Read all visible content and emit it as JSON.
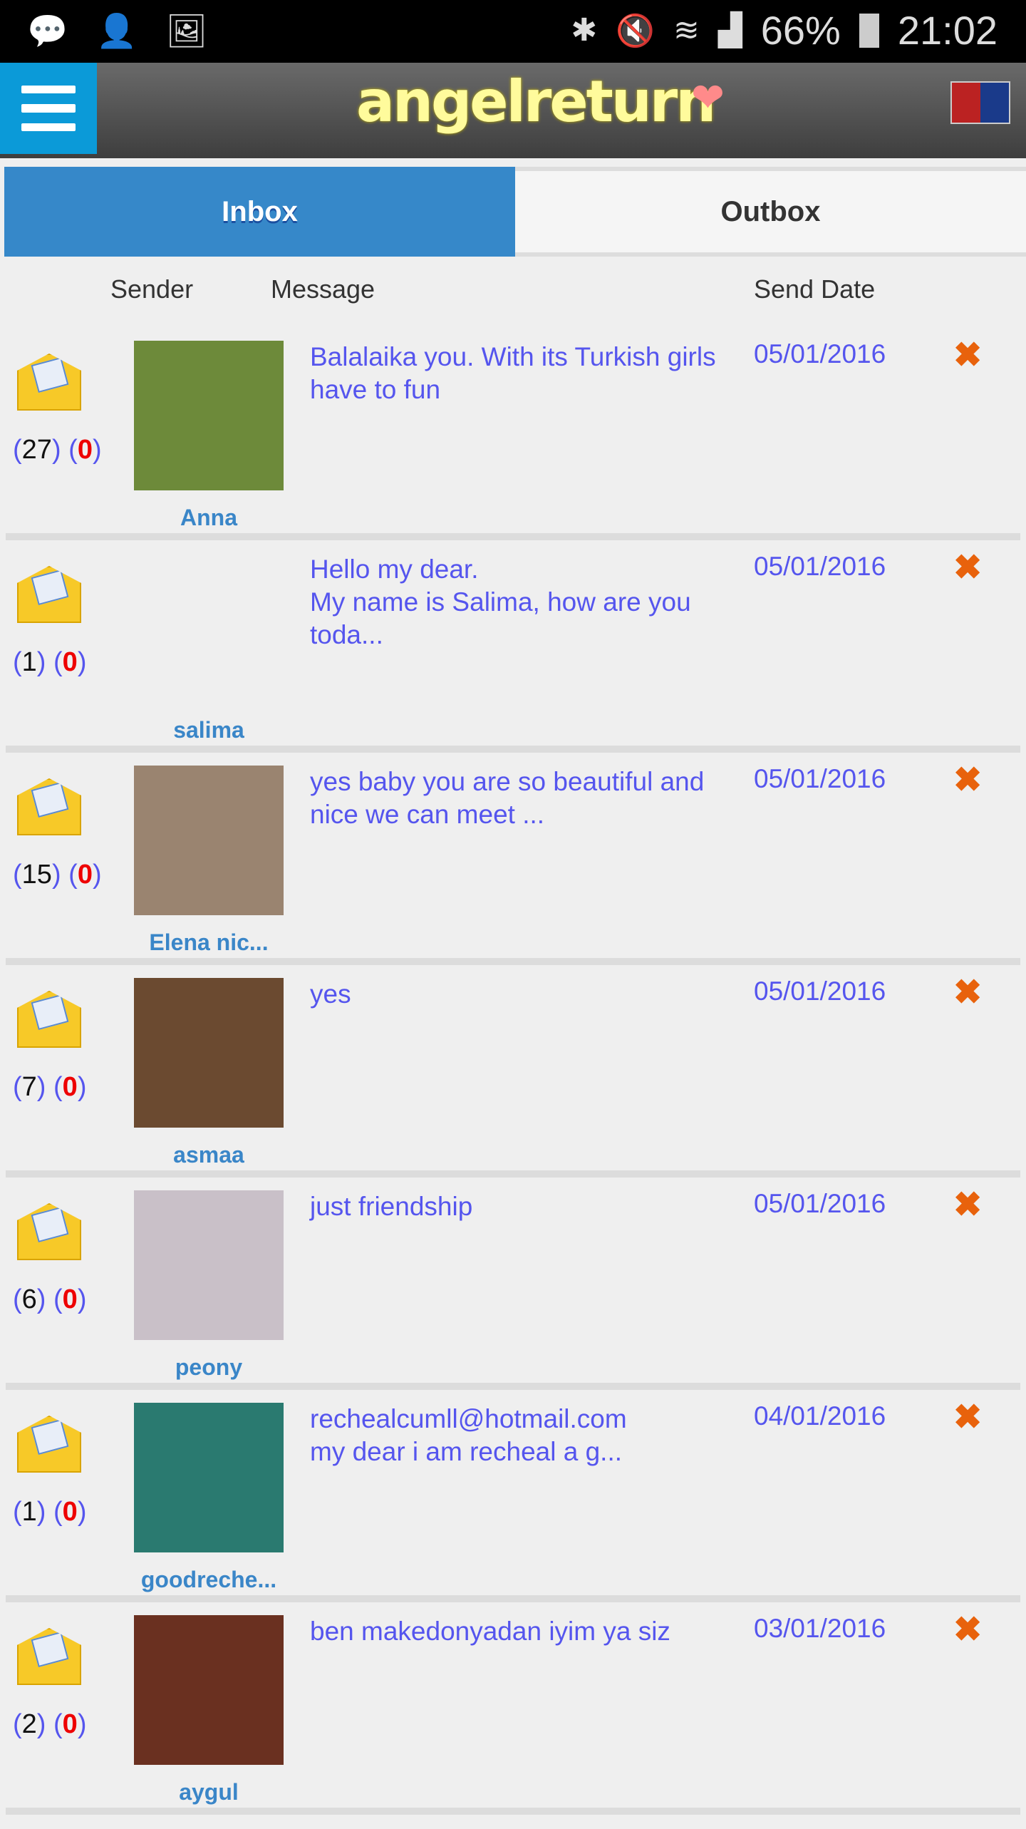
{
  "status_bar": {
    "battery": "66%",
    "time": "21:02"
  },
  "header": {
    "title": "angelreturn",
    "language": "English"
  },
  "tabs": [
    {
      "label": "Inbox",
      "active": true
    },
    {
      "label": "Outbox",
      "active": false
    }
  ],
  "columns": {
    "sender": "Sender",
    "message": "Message",
    "date": "Send Date"
  },
  "colors": {
    "accent": "#3688c9",
    "message": "#5555ee",
    "unread": "#e00000",
    "delete": "#e8620c"
  },
  "messages": [
    {
      "count": "27",
      "unread": "0",
      "name": "Anna",
      "text": "Balalaika you. With its Turkish girls have to fun",
      "date": "05/01/2016",
      "avatar": "#6d8a3a"
    },
    {
      "count": "1",
      "unread": "0",
      "name": "salima",
      "text": "Hello my dear.\nMy name is Salima, how are you toda...",
      "date": "05/01/2016",
      "avatar": "#efefef"
    },
    {
      "count": "15",
      "unread": "0",
      "name": "Elena nic...",
      "text": "yes baby you are so beautiful and nice we can meet ...",
      "date": "05/01/2016",
      "avatar": "#9a8470"
    },
    {
      "count": "7",
      "unread": "0",
      "name": "asmaa",
      "text": "yes",
      "date": "05/01/2016",
      "avatar": "#6b4a30"
    },
    {
      "count": "6",
      "unread": "0",
      "name": "peony",
      "text": "just friendship",
      "date": "05/01/2016",
      "avatar": "#c9c0c8"
    },
    {
      "count": "1",
      "unread": "0",
      "name": "goodreche...",
      "text": "rechealcumll@hotmail.com\nmy dear i am recheal a g...",
      "date": "04/01/2016",
      "avatar": "#2a7a70"
    },
    {
      "count": "2",
      "unread": "0",
      "name": "aygul",
      "text": "ben makedonyadan iyim ya siz",
      "date": "03/01/2016",
      "avatar": "#6a3020"
    }
  ]
}
